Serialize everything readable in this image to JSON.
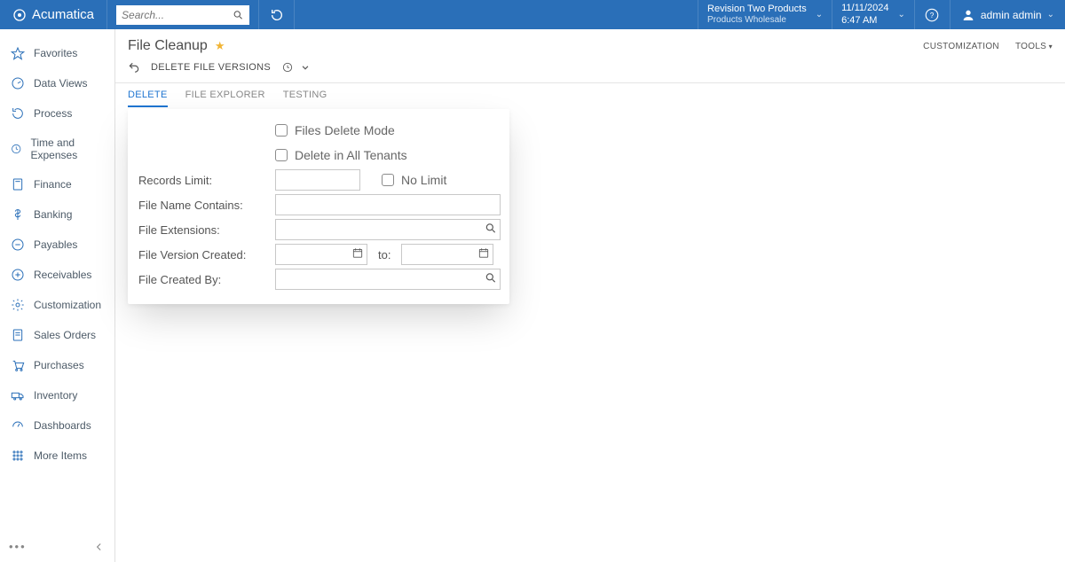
{
  "header": {
    "brand": "Acumatica",
    "search_placeholder": "Search...",
    "tenant": {
      "name": "Revision Two Products",
      "sub": "Products Wholesale"
    },
    "datetime": {
      "date": "11/11/2024",
      "time": "6:47 AM"
    },
    "user": "admin admin"
  },
  "sidebar": {
    "items": [
      {
        "label": "Favorites"
      },
      {
        "label": "Data Views"
      },
      {
        "label": "Process"
      },
      {
        "label": "Time and Expenses"
      },
      {
        "label": "Finance"
      },
      {
        "label": "Banking"
      },
      {
        "label": "Payables"
      },
      {
        "label": "Receivables"
      },
      {
        "label": "Customization"
      },
      {
        "label": "Sales Orders"
      },
      {
        "label": "Purchases"
      },
      {
        "label": "Inventory"
      },
      {
        "label": "Dashboards"
      },
      {
        "label": "More Items"
      }
    ]
  },
  "page": {
    "title": "File Cleanup",
    "links": {
      "customization": "CUSTOMIZATION",
      "tools": "TOOLS"
    },
    "toolbar": {
      "action": "DELETE FILE VERSIONS"
    },
    "tabs": [
      {
        "label": "DELETE",
        "active": true
      },
      {
        "label": "FILE EXPLORER",
        "active": false
      },
      {
        "label": "TESTING",
        "active": false
      }
    ]
  },
  "form": {
    "files_delete_mode": "Files Delete Mode",
    "delete_all_tenants": "Delete in All Tenants",
    "records_limit": "Records Limit:",
    "no_limit": "No Limit",
    "file_name_contains": "File Name Contains:",
    "file_extensions": "File Extensions:",
    "file_version_created": "File Version Created:",
    "to": "to:",
    "file_created_by": "File Created By:"
  }
}
